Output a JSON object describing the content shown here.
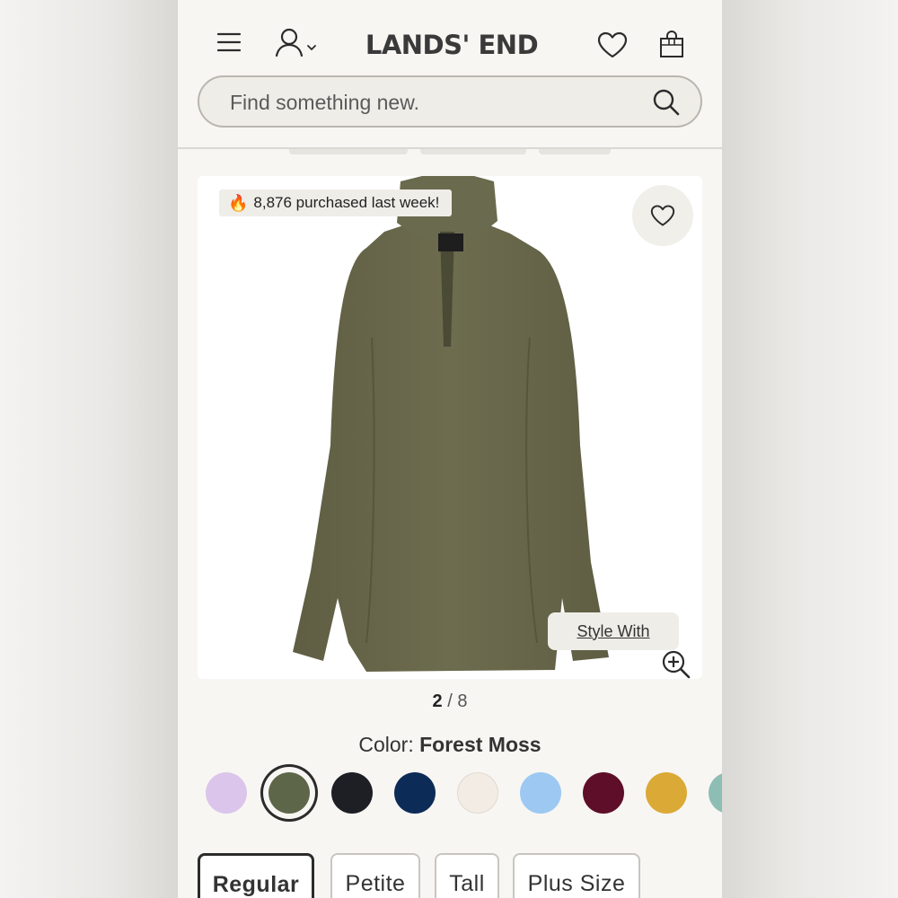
{
  "header": {
    "logo": "LANDS' END",
    "icons": {
      "menu": "hamburger-icon",
      "account": "user-icon",
      "wishlist": "heart-icon",
      "bag": "shopping-bag-icon"
    }
  },
  "search": {
    "placeholder": "Find something new.",
    "icon": "search-icon"
  },
  "product": {
    "badge": "8,876 purchased last week!",
    "style_with": "Style With",
    "image_index": "2",
    "image_total": "8",
    "pager_sep": "/",
    "color_label": "Color:",
    "color_value": "Forest Moss",
    "garment_color": "#6b6a4c"
  },
  "swatches": [
    {
      "name": "lavender",
      "color": "#dcc5ea",
      "selected": false
    },
    {
      "name": "forest-moss",
      "color": "#5d6649",
      "selected": true
    },
    {
      "name": "black",
      "color": "#1d1f24",
      "selected": false
    },
    {
      "name": "navy",
      "color": "#0d2b57",
      "selected": false
    },
    {
      "name": "ivory",
      "color": "#f3ece4",
      "selected": false
    },
    {
      "name": "light-blue",
      "color": "#9cc8f2",
      "selected": false
    },
    {
      "name": "burgundy",
      "color": "#5e0e28",
      "selected": false
    },
    {
      "name": "gold",
      "color": "#dba936",
      "selected": false
    },
    {
      "name": "teal",
      "color": "#8ebdb3",
      "selected": false
    }
  ],
  "fits": [
    {
      "label": "Regular",
      "active": true
    },
    {
      "label": "Petite",
      "active": false
    },
    {
      "label": "Tall",
      "active": false
    },
    {
      "label": "Plus Size",
      "active": false
    }
  ]
}
